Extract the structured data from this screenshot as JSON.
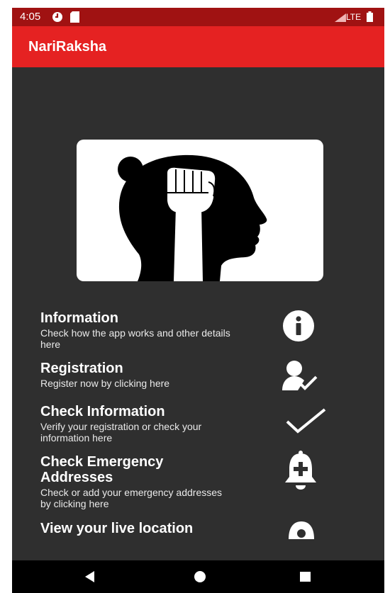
{
  "status_bar": {
    "time": "4:05",
    "network": "LTE",
    "icons": [
      "sync-icon",
      "sd-card-icon",
      "signal-icon",
      "battery-icon"
    ]
  },
  "app_bar": {
    "title": "NariRaksha"
  },
  "hero": {
    "image": "woman-silhouette-raised-fist-logo"
  },
  "menu": [
    {
      "title": "Information",
      "description": "Check how the app works and other details here",
      "icon": "info-icon"
    },
    {
      "title": "Registration",
      "description": "Register now by clicking here",
      "icon": "user-check-icon"
    },
    {
      "title": "Check Information",
      "description": "Verify your registration or check your information here",
      "icon": "checkmark-icon"
    },
    {
      "title": "Check Emergency Addresses",
      "description": "Check or add your emergency addresses by clicking here",
      "icon": "bell-plus-icon"
    },
    {
      "title": "View your live location",
      "description": "",
      "icon": "location-icon"
    }
  ],
  "nav_bar": {
    "buttons": [
      "back-icon",
      "home-icon",
      "recents-icon"
    ]
  },
  "colors": {
    "app_bar": "#e52222",
    "status_bar": "#a01212",
    "background": "#2f2f2f",
    "nav_bar": "#000000"
  }
}
